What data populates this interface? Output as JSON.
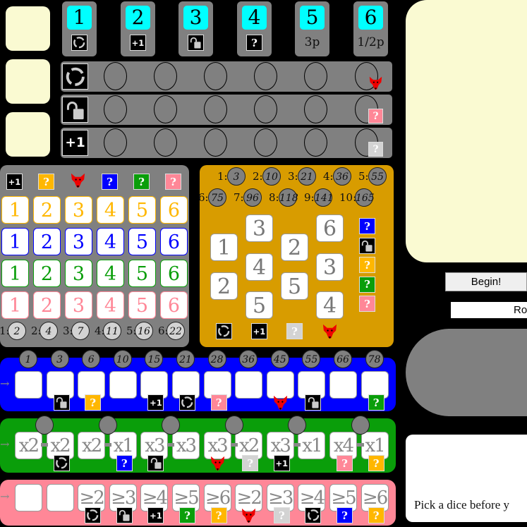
{
  "colors": {
    "yellow": "#ffb700",
    "blue": "#0000ff",
    "green": "#0a9e0a",
    "pink": "#ff8797",
    "gray": "#808080",
    "orange": "#d89c00",
    "cyan": "#00ffff",
    "cream": "#fafad2"
  },
  "top_cards": [
    {
      "number": "1",
      "icon": "reroll"
    },
    {
      "number": "2",
      "icon": "plus-one"
    },
    {
      "number": "3",
      "icon": "lock"
    },
    {
      "number": "4",
      "icon": "q-black"
    },
    {
      "number": "5",
      "text": "3p"
    },
    {
      "number": "6",
      "text": "1/2p"
    }
  ],
  "bonus_rows": [
    {
      "icon": "reroll",
      "end_icon": "fox"
    },
    {
      "icon": "lock",
      "end_icon": "q-pink"
    },
    {
      "icon": "plus-one",
      "end_icon": "q-gray"
    }
  ],
  "gray_panel": {
    "header_icons": [
      "plus-one",
      "q-yellow",
      "fox",
      "q-blue",
      "q-green",
      "q-pink"
    ],
    "rows": [
      {
        "color": "yellow",
        "values": [
          "1",
          "2",
          "3",
          "4",
          "5",
          "6"
        ]
      },
      {
        "color": "blue",
        "values": [
          "1",
          "2",
          "3",
          "4",
          "5",
          "6"
        ]
      },
      {
        "color": "green",
        "values": [
          "1",
          "2",
          "3",
          "4",
          "5",
          "6"
        ]
      },
      {
        "color": "pink",
        "values": [
          "1",
          "2",
          "3",
          "4",
          "5",
          "6"
        ]
      }
    ],
    "scores": [
      {
        "label": "1:",
        "value": "2"
      },
      {
        "label": "2:",
        "value": "4"
      },
      {
        "label": "3:",
        "value": "7"
      },
      {
        "label": "4:",
        "value": "11"
      },
      {
        "label": "5:",
        "value": "16"
      },
      {
        "label": "6:",
        "value": "22"
      }
    ]
  },
  "orange_panel": {
    "scores": [
      {
        "label": "1:",
        "value": "3"
      },
      {
        "label": "2:",
        "value": "10"
      },
      {
        "label": "3:",
        "value": "21"
      },
      {
        "label": "4:",
        "value": "36"
      },
      {
        "label": "5:",
        "value": "55"
      },
      {
        "label": "6:",
        "value": "75"
      },
      {
        "label": "7:",
        "value": "96"
      },
      {
        "label": "8:",
        "value": "118"
      },
      {
        "label": "9:",
        "value": "141"
      },
      {
        "label": "10:",
        "value": "165"
      }
    ],
    "columns": [
      [
        "1",
        "2"
      ],
      [
        "3",
        "4",
        "5"
      ],
      [
        "2",
        "5"
      ],
      [
        "6",
        "3",
        "4"
      ]
    ],
    "side_icons": [
      "q-blue",
      "lock",
      "q-yellow",
      "q-green",
      "q-pink"
    ],
    "bottom_icons": [
      "reroll",
      "plus-one",
      "q-gray",
      "fox"
    ]
  },
  "blue_track": {
    "scores": [
      "1",
      "3",
      "6",
      "10",
      "15",
      "21",
      "28",
      "36",
      "45",
      "55",
      "66",
      "78"
    ],
    "icons": [
      "",
      "lock",
      "q-yellow",
      "",
      "plus-one",
      "reroll",
      "q-pink",
      "",
      "fox",
      "lock",
      "",
      "q-green"
    ]
  },
  "green_track": {
    "labels": [
      "x2",
      "x2",
      "x2",
      "x1",
      "x3",
      "x3",
      "x3",
      "x2",
      "x3",
      "x1",
      "x4",
      "x1"
    ],
    "icons": [
      "",
      "reroll",
      "",
      "q-blue",
      "lock",
      "",
      "fox",
      "q-gray",
      "plus-one",
      "",
      "q-pink",
      "q-yellow"
    ]
  },
  "pink_track": {
    "labels": [
      "",
      "",
      "≥2",
      "≥3",
      "≥4",
      "≥5",
      "≥6",
      "≥2",
      "≥3",
      "≥4",
      "≥5",
      "≥6"
    ],
    "icons": [
      "",
      "",
      "reroll",
      "lock",
      "plus-one",
      "q-green",
      "q-yellow",
      "fox",
      "q-gray",
      "reroll",
      "q-blue",
      "q-yellow"
    ]
  },
  "controls": {
    "begin_label": "Begin!",
    "round_label": "Ro",
    "message": "Pick a dice before y"
  },
  "arrow": "→",
  "plus_one": "+1",
  "question": "?"
}
